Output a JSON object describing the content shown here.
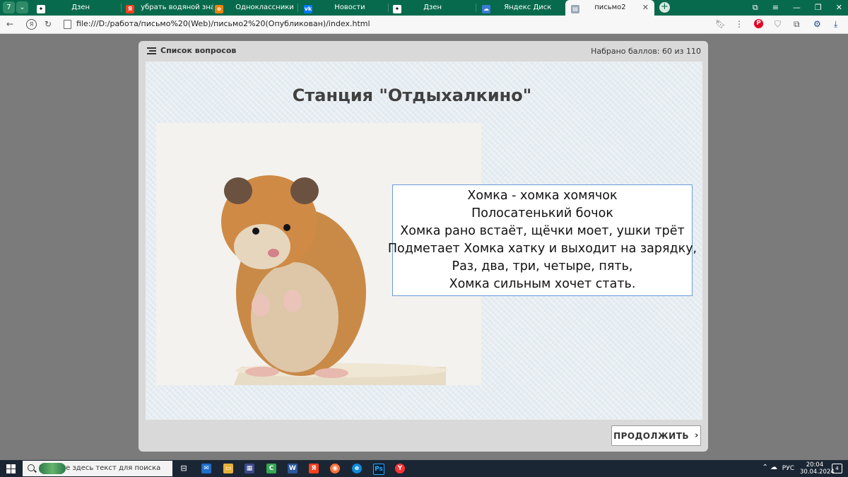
{
  "browser": {
    "tabs": [
      {
        "label": "Дзен",
        "icon": "dzen-icon",
        "color": "#000000"
      },
      {
        "label": "убрать водяной знак с ви",
        "icon": "yandex-icon",
        "color": "#fc3f1d"
      },
      {
        "label": "Одноклассники",
        "icon": "ok-icon",
        "color": "#ee8208"
      },
      {
        "label": "Новости",
        "icon": "vk-icon",
        "color": "#0077ff"
      },
      {
        "label": "Дзен",
        "icon": "dzen-icon",
        "color": "#000000"
      },
      {
        "label": "Яндекс Диск",
        "icon": "yandex-disk-icon",
        "color": "#3a7bd5"
      },
      {
        "label": "письмо2",
        "icon": "page-icon",
        "color": "#9aa7b5"
      }
    ],
    "tab_counter": "7",
    "new_tab_symbol": "+",
    "address": "file:///D:/работа/письмо%20(Web)/письмо2%20(Опубликован)/index.html",
    "accent": "#086a4c"
  },
  "player": {
    "question_list_label": "Список вопросов",
    "score_text": "Набрано баллов: 60 из 110",
    "slide_title": "Станция \"Отдыхалкино\"",
    "poem_lines": [
      "Хомка - хомка хомячок",
      "Полосатенький бочок",
      "Хомка рано встаёт, щёчки моет, ушки трёт",
      "Подметает Хомка хатку и выходит на зарядку,",
      "Раз, два, три, четыре, пять,",
      "Хомка сильным хочет стать."
    ],
    "continue_label": "ПРОДОЛЖИТЬ",
    "continue_icon": "chevron-right-icon"
  },
  "taskbar": {
    "search_placeholder": "Введите здесь текст для поиска",
    "language": "РУС",
    "time": "20:04",
    "date": "30.04.2024",
    "notification_count": "4"
  }
}
